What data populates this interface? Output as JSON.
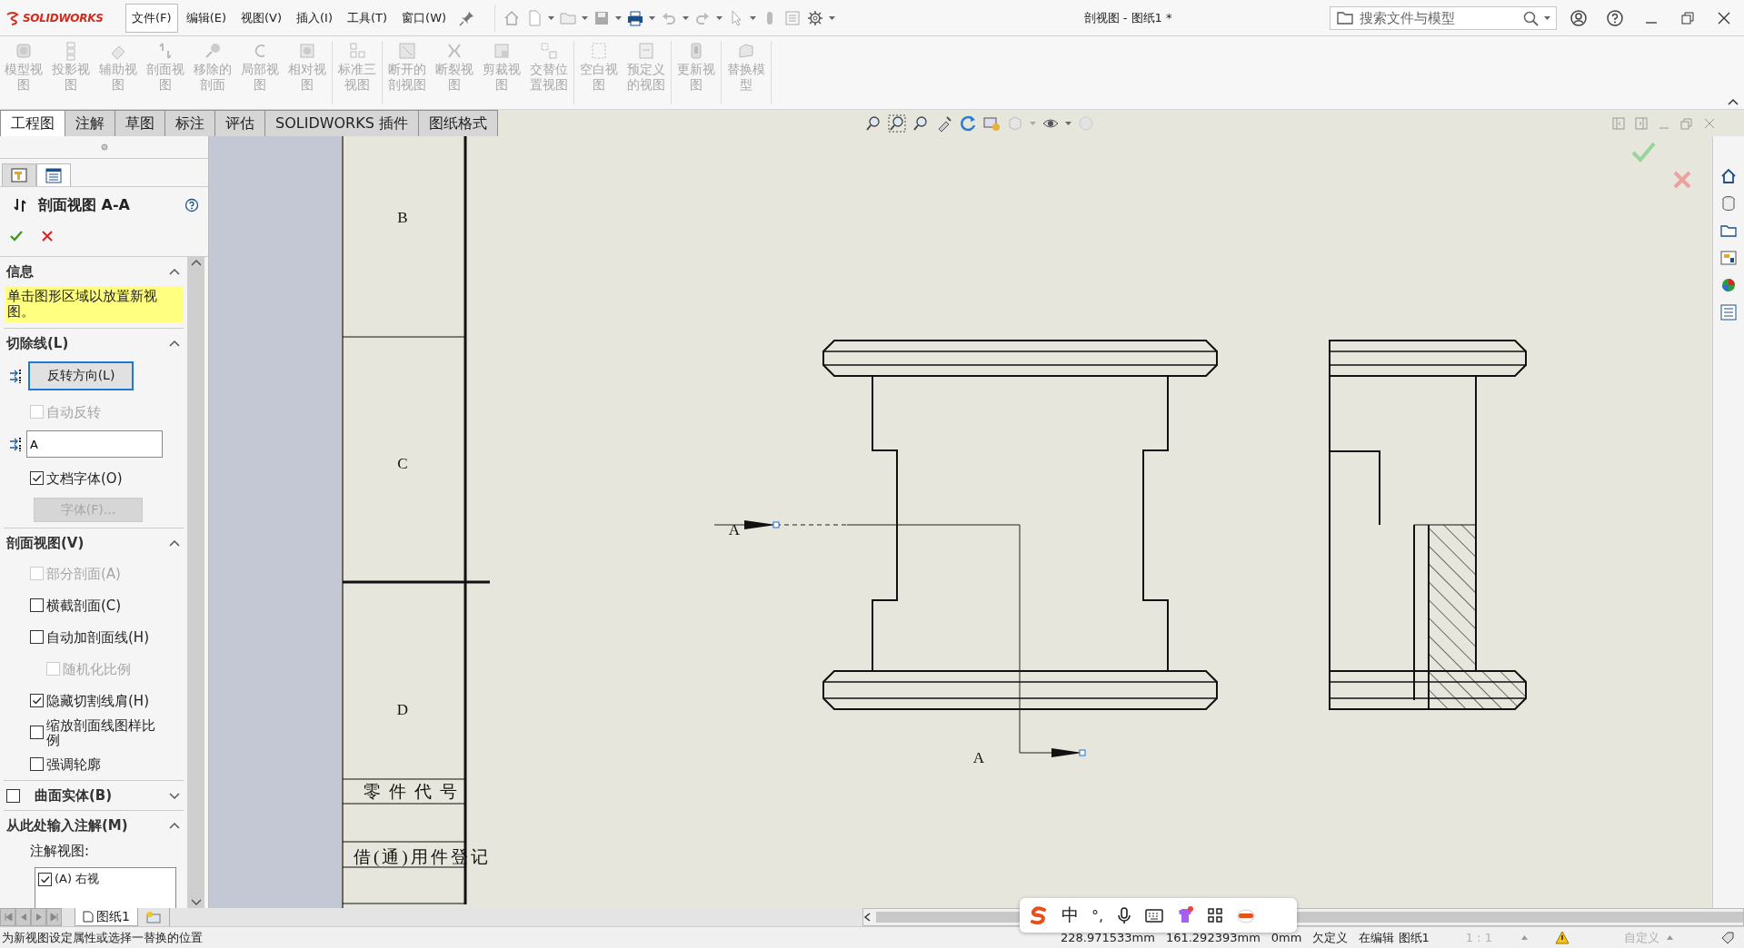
{
  "logo": {
    "text": "SOLIDWORKS"
  },
  "menu": [
    {
      "label": "文件(F)",
      "selected": true
    },
    {
      "label": "编辑(E)",
      "selected": false
    },
    {
      "label": "视图(V)",
      "selected": false
    },
    {
      "label": "插入(I)",
      "selected": false
    },
    {
      "label": "工具(T)",
      "selected": false
    },
    {
      "label": "窗口(W)",
      "selected": false
    }
  ],
  "window": {
    "title": "剖视图 - 图纸1 *"
  },
  "search": {
    "placeholder": "搜索文件与模型"
  },
  "command_groups": [
    {
      "buttons": [
        {
          "label": "模型视图",
          "disabled": true
        },
        {
          "label": "投影视图",
          "disabled": true
        },
        {
          "label": "辅助视图",
          "disabled": true
        },
        {
          "label": "剖面视图",
          "disabled": true
        },
        {
          "label": "移除的剖面",
          "disabled": true
        },
        {
          "label": "局部视图",
          "disabled": true
        },
        {
          "label": "相对视图",
          "disabled": true
        }
      ]
    },
    {
      "buttons": [
        {
          "label": "标准三视图",
          "disabled": true
        }
      ]
    },
    {
      "buttons": [
        {
          "label": "断开的剖视图",
          "disabled": true
        },
        {
          "label": "断裂视图",
          "disabled": true
        },
        {
          "label": "剪裁视图",
          "disabled": true
        },
        {
          "label": "交替位置视图",
          "disabled": true
        }
      ]
    },
    {
      "buttons": [
        {
          "label": "空白视图",
          "disabled": true
        },
        {
          "label": "预定义的视图",
          "disabled": true
        }
      ]
    },
    {
      "buttons": [
        {
          "label": "更新视图",
          "disabled": true
        }
      ]
    },
    {
      "buttons": [
        {
          "label": "替换模型",
          "disabled": true
        }
      ]
    }
  ],
  "tabs": [
    {
      "label": "工程图",
      "selected": true
    },
    {
      "label": "注解",
      "selected": false
    },
    {
      "label": "草图",
      "selected": false
    },
    {
      "label": "标注",
      "selected": false
    },
    {
      "label": "评估",
      "selected": false
    },
    {
      "label": "SOLIDWORKS 插件",
      "selected": false
    },
    {
      "label": "图纸格式",
      "selected": false
    }
  ],
  "property_manager": {
    "tabs": [
      {
        "selected": false
      },
      {
        "selected": true
      }
    ],
    "title": "剖面视图 A-A",
    "sections": [
      {
        "title": "信息",
        "expanded": true,
        "items": [
          {
            "kind": "message",
            "text": "单击图形区域以放置新视图。"
          }
        ]
      },
      {
        "title": "切除线(L)",
        "expanded": true,
        "items": [
          {
            "kind": "button",
            "label": "反转方向(L)",
            "disabled": false,
            "focused": true
          },
          {
            "kind": "checkbox",
            "label": "自动反转",
            "checked": false,
            "disabled": true
          },
          {
            "kind": "text_field",
            "value": "A"
          },
          {
            "kind": "checkbox",
            "label": "文档字体(O)",
            "checked": true,
            "disabled": false
          },
          {
            "kind": "button",
            "label": "字体(F)...",
            "disabled": true,
            "focused": false
          }
        ]
      },
      {
        "title": "剖面视图(V)",
        "expanded": true,
        "items": [
          {
            "kind": "checkbox",
            "label": "部分剖面(A)",
            "checked": false,
            "disabled": true
          },
          {
            "kind": "checkbox",
            "label": "横截剖面(C)",
            "checked": false,
            "disabled": false
          },
          {
            "kind": "checkbox",
            "label": "自动加剖面线(H)",
            "checked": false,
            "disabled": false,
            "children": [
              {
                "kind": "checkbox",
                "label": "随机化比例",
                "checked": false,
                "disabled": true
              }
            ]
          },
          {
            "kind": "checkbox",
            "label": "隐藏切割线肩(H)",
            "checked": true,
            "disabled": false
          },
          {
            "kind": "checkbox",
            "label": "缩放剖面线图样比例",
            "checked": false,
            "disabled": false
          },
          {
            "kind": "checkbox",
            "label": "强调轮廓",
            "checked": false,
            "disabled": false
          }
        ]
      },
      {
        "title": "曲面实体(B)",
        "expanded": false,
        "checked": false
      },
      {
        "title": "从此处输入注解(M)",
        "expanded": true,
        "items": [
          {
            "kind": "label",
            "text": "注解视图:"
          },
          {
            "kind": "list",
            "entries": [
              {
                "label": "(A) 右视",
                "checked": true
              }
            ]
          }
        ]
      }
    ]
  },
  "drawing": {
    "zone_labels": [
      "B",
      "C",
      "D"
    ],
    "title_block": [
      "零件代号",
      "借(通)用件登记"
    ],
    "section_labels": [
      "A",
      "A"
    ]
  },
  "sheet_tabs": [
    {
      "label": "图纸1",
      "selected": true
    }
  ],
  "status_bar": {
    "message": "为新视图设定属性或选择一替换的位置",
    "fields": [
      {
        "text": "228.971533mm",
        "disabled": false
      },
      {
        "text": "161.292393mm",
        "disabled": false
      },
      {
        "text": "0mm",
        "disabled": false
      },
      {
        "text": "欠定义",
        "disabled": false
      },
      {
        "text": "在编辑 图纸1",
        "disabled": false
      },
      {
        "text": "1 : 1",
        "disabled": true
      },
      {
        "text": "自定义",
        "disabled": true
      }
    ]
  },
  "ime_toolbar": {
    "mode": "中",
    "punctuation": "°,"
  }
}
